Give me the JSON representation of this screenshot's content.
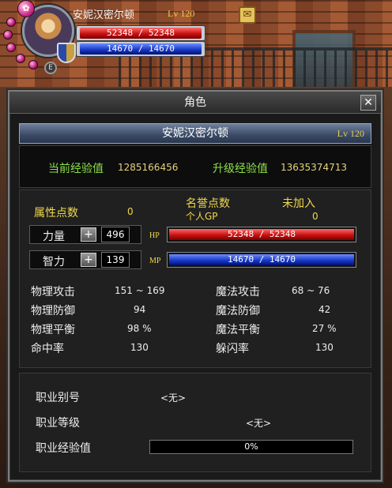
{
  "hud": {
    "name": "安妮汉密尔顿",
    "level": "Lv 120",
    "hp_text": "52348 / 52348",
    "mp_text": "14670 / 14670",
    "hp_fraction": 1.0,
    "mp_fraction": 1.0
  },
  "window": {
    "title": "角色",
    "close_glyph": "✕"
  },
  "character": {
    "name": "安妮汉密尔顿",
    "level": "Lv 120",
    "current_exp_label": "当前经验值",
    "current_exp_value": "1285166456",
    "next_exp_label": "升级经验值",
    "next_exp_value": "13635374713"
  },
  "points": {
    "attr_label": "属性点数",
    "attr_value": "0",
    "honor_label": "名誉点数",
    "guild_gp_label": "个人GP",
    "guild_status": "未加入",
    "guild_gp_value": "0"
  },
  "primary": {
    "str_label": "力量",
    "str_value": "496",
    "int_label": "智力",
    "int_value": "139",
    "plus_glyph": "+",
    "hp_tag": "HP",
    "mp_tag": "MP",
    "hp_text": "52348 / 52348",
    "mp_text": "14670 / 14670"
  },
  "combat": {
    "patk_label": "物理攻击",
    "patk_value": "151 ~ 169",
    "matk_label": "魔法攻击",
    "matk_value": "68 ~ 76",
    "pdef_label": "物理防御",
    "pdef_value": "94",
    "mdef_label": "魔法防御",
    "mdef_value": "42",
    "pbal_label": "物理平衡",
    "pbal_value": "98 %",
    "mbal_label": "魔法平衡",
    "mbal_value": "27 %",
    "hit_label": "命中率",
    "hit_value": "130",
    "dodge_label": "躲闪率",
    "dodge_value": "130"
  },
  "job": {
    "alias_label": "职业别号",
    "alias_value": "<无>",
    "grade_label": "职业等级",
    "grade_value": "<无>",
    "exp_label": "职业经验值",
    "exp_text": "0%",
    "exp_fraction": 0
  },
  "colors": {
    "exp_green": "#8ce04a",
    "stat_yellow": "#f0d84a",
    "hp_red": "#c81010",
    "mp_blue": "#1a3ac8",
    "header_blue": "#3a4a66"
  },
  "icons": [
    "pink-orb-icon",
    "shield-emblem-icon",
    "envelope-icon",
    "close-icon",
    "plus-icon"
  ]
}
